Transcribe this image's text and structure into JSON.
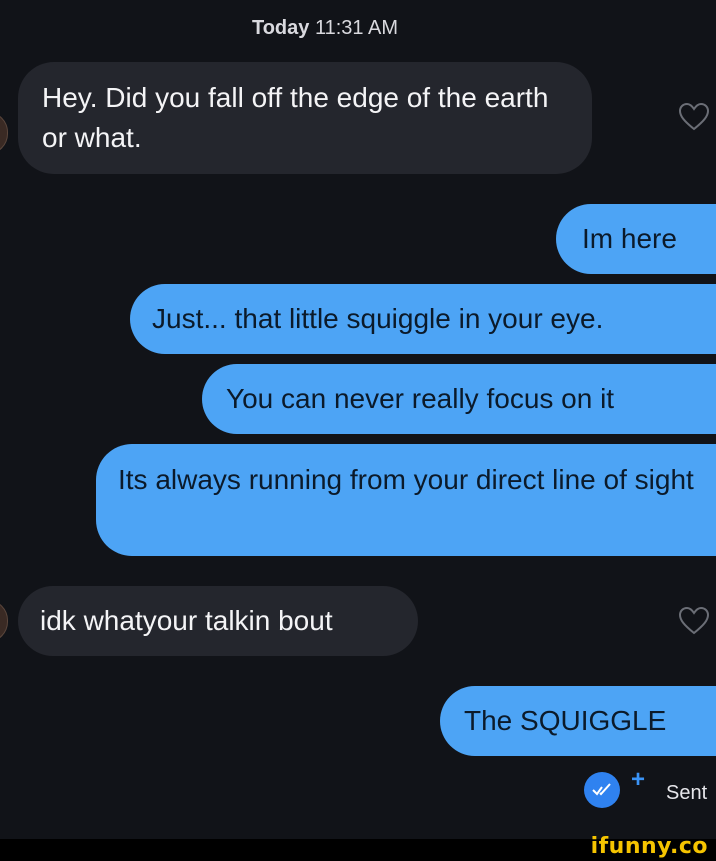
{
  "header": {
    "day": "Today",
    "time": "11:31 AM"
  },
  "messages": [
    {
      "side": "in",
      "text": "Hey. Did you fall off the edge of the earth or what."
    },
    {
      "side": "out",
      "text": "Im here"
    },
    {
      "side": "out",
      "text": "Just... that little squiggle in your eye."
    },
    {
      "side": "out",
      "text": "You can never really focus on it"
    },
    {
      "side": "out",
      "text": "Its always running from your direct line of sight"
    },
    {
      "side": "in",
      "text": "idk whatyour talkin bout"
    },
    {
      "side": "out",
      "text": "The SQUIGGLE"
    }
  ],
  "status": {
    "label": "Sent",
    "plus": "+"
  },
  "watermark": {
    "text": "ifunny.co"
  },
  "colors": {
    "incoming": "#24262d",
    "outgoing": "#4da4f5",
    "read_icon": "#2f82f0",
    "background": "#111318"
  },
  "icons": [
    "heart-outline-icon",
    "double-check-icon",
    "plus-icon"
  ]
}
